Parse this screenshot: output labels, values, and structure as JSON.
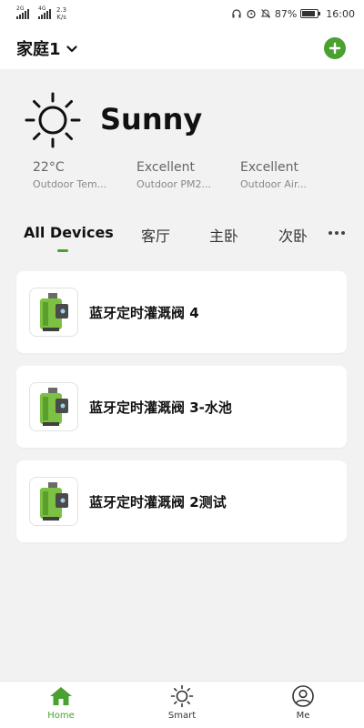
{
  "status_bar": {
    "sim1": "2G",
    "sim2": "4G",
    "net_speed_value": "2.3",
    "net_speed_unit": "K/s",
    "battery": "87%",
    "battery_level": 0.87,
    "time": "16:00"
  },
  "header": {
    "home_name": "家庭1"
  },
  "weather": {
    "condition": "Sunny",
    "items": [
      {
        "value": "22°C",
        "label": "Outdoor Tem..."
      },
      {
        "value": "Excellent",
        "label": "Outdoor PM2..."
      },
      {
        "value": "Excellent",
        "label": "Outdoor Air..."
      }
    ]
  },
  "tabs": [
    {
      "label": "All Devices",
      "active": true
    },
    {
      "label": "客厅",
      "active": false
    },
    {
      "label": "主卧",
      "active": false
    },
    {
      "label": "次卧",
      "active": false
    }
  ],
  "devices": [
    {
      "name": "蓝牙定时灌溉阀 4"
    },
    {
      "name": "蓝牙定时灌溉阀 3-水池"
    },
    {
      "name": "蓝牙定时灌溉阀 2测试"
    }
  ],
  "bottom_nav": [
    {
      "label": "Home",
      "icon": "home-icon",
      "active": true
    },
    {
      "label": "Smart",
      "icon": "sun-icon",
      "active": false
    },
    {
      "label": "Me",
      "icon": "user-icon",
      "active": false
    }
  ],
  "colors": {
    "accent": "#4aa030",
    "background": "#f2f2f2",
    "card": "#ffffff"
  }
}
